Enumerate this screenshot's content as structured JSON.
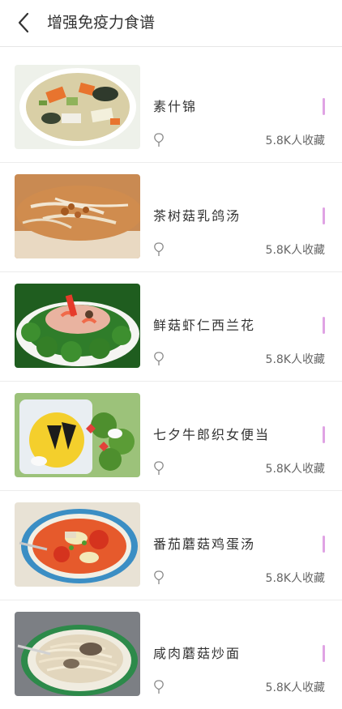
{
  "header": {
    "title": "增强免疫力食谱",
    "back_icon": "back-chevron-icon"
  },
  "colors": {
    "accent": "#e0a3e4",
    "text": "#333333",
    "muted": "#666666",
    "divider": "#ececec"
  },
  "recipes": [
    {
      "name": "素什锦",
      "count": "5.8K人收藏",
      "image": "mixed-vegetables-photo",
      "icon": "favorite-icon"
    },
    {
      "name": "茶树菇乳鸽汤",
      "count": "5.8K人收藏",
      "image": "mushroom-pigeon-soup-photo",
      "icon": "favorite-icon"
    },
    {
      "name": "鲜菇虾仁西兰花",
      "count": "5.8K人收藏",
      "image": "shrimp-broccoli-photo",
      "icon": "favorite-icon"
    },
    {
      "name": "七夕牛郎织女便当",
      "count": "5.8K人收藏",
      "image": "bento-photo",
      "icon": "favorite-icon"
    },
    {
      "name": "番茄蘑菇鸡蛋汤",
      "count": "5.8K人收藏",
      "image": "tomato-egg-soup-photo",
      "icon": "favorite-icon"
    },
    {
      "name": "咸肉蘑菇炒面",
      "count": "5.8K人收藏",
      "image": "fried-noodles-photo",
      "icon": "favorite-icon"
    }
  ]
}
